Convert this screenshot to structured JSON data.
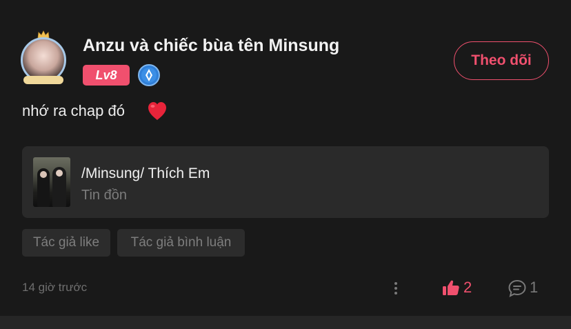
{
  "post": {
    "author": {
      "name": "Anzu và chiếc bùa tên Minsung",
      "level": "Lv8",
      "avatar_icon": "user-avatar-with-crown-frame",
      "verify_icon": "diamond-badge-icon"
    },
    "follow_label": "Theo dõi",
    "text": "nhớ ra chap đó",
    "emoji": "heart-emoji",
    "linked_story": {
      "title": "/Minsung/ Thích Em",
      "subtitle": "Tin đồn"
    },
    "tags": [
      "Tác giả like",
      "Tác giả bình luận"
    ],
    "timestamp": "14 giờ trước",
    "likes": "2",
    "comments": "1"
  },
  "colors": {
    "background": "#191919",
    "accent": "#f0506e",
    "card": "#2a2a2a",
    "muted_text": "#7c7c7c"
  }
}
